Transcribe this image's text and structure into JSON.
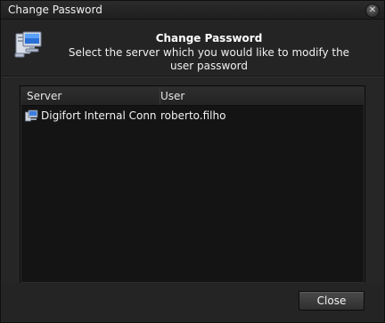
{
  "window": {
    "title": "Change Password"
  },
  "header": {
    "title": "Change Password",
    "subtitle": "Select the server which you would like to modify the user password",
    "icon": "computer-network-icon"
  },
  "list": {
    "columns": [
      "Server",
      "User"
    ],
    "rows": [
      {
        "server": "Digifort Internal Conn...",
        "user": "roberto.filho",
        "icon": "server-computer-icon"
      }
    ]
  },
  "buttons": {
    "close_label": "Close"
  },
  "colors": {
    "background": "#262626",
    "list_background": "#141414",
    "text": "#e8e8e8"
  }
}
